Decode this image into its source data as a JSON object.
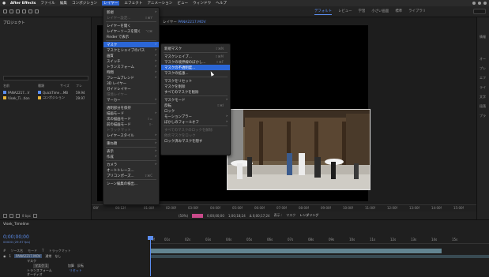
{
  "menubar": {
    "app": "After Effects",
    "items": [
      "ファイル",
      "編集",
      "コンポジション",
      "レイヤー",
      "エフェクト",
      "アニメーション",
      "ビュー",
      "ウィンドウ",
      "ヘルプ"
    ],
    "active_index": 3
  },
  "workspaces": [
    "デフォルト",
    "レビュー",
    "学習",
    "小さい画面",
    "標準",
    "ライブラリ"
  ],
  "project": {
    "title": "プロジェクト",
    "columns": [
      "名前",
      "種類",
      "サイズ",
      "フレ"
    ],
    "items": [
      {
        "name": "PANA2217...V",
        "type": "QuickTime",
        "size": "...MB",
        "fps": "59.94",
        "color": "#5b8def"
      },
      {
        "name": "Visek_Ti...tion",
        "type": "コンポジション",
        "size": "",
        "fps": "29.97",
        "color": "#e7b43a"
      }
    ],
    "bpc": "8 bpc"
  },
  "comp": {
    "tab_label": "レイヤー",
    "tab_name": "PANA2217.MOV",
    "ruler": [
      "00f",
      "00:12f",
      "01:00f",
      "02:00f",
      "03:00f",
      "04:00f",
      "05:00f",
      "06:00f",
      "07:00f",
      "08:00f",
      "09:00f",
      "10:00f",
      "11:00f",
      "12:00f",
      "13:00f",
      "14:00f",
      "15:00f"
    ],
    "viewbar": {
      "zoom": "(50%)",
      "time1": "0;00;00;00",
      "time2": "1;00;18;24",
      "delta": "Δ 0;00;17;24",
      "view_label": "表示 :",
      "view_value": "マスク",
      "render": "レンダリング"
    }
  },
  "right_panel": [
    "情報",
    "オー",
    "プレ",
    "エフ",
    "ライ",
    "文字",
    "段落",
    "ブラ"
  ],
  "timeline": {
    "tab": "Visek_Timeline",
    "time": "0;00;00;00",
    "frames": "00000 (29.97 fps)",
    "cols": [
      "#",
      "ソース名",
      "モード",
      "T",
      "トラックマット"
    ],
    "layers": [
      {
        "num": "1",
        "name": "PANA2217.MOV",
        "mode": "通常",
        "matte": "なし"
      },
      {
        "num": "",
        "name": "マスク",
        "mode": "",
        "matte": ""
      },
      {
        "num": "",
        "name": "マスク 1",
        "mode": "加算",
        "matte": "反転"
      },
      {
        "num": "",
        "name": "トランスフォーム",
        "mode": "リセット",
        "matte": ""
      },
      {
        "num": "",
        "name": "オーディオ",
        "mode": "",
        "matte": ""
      }
    ],
    "ruler": [
      "0f",
      "01s",
      "02s",
      "03s",
      "04s",
      "05s",
      "06s",
      "07s",
      "08s",
      "09s",
      "10s",
      "11s",
      "12s",
      "13s",
      "14s",
      "15s"
    ]
  },
  "menu_layer": {
    "items": [
      {
        "label": "新規",
        "arrow": true
      },
      {
        "label": "レイヤー設定...",
        "disabled": true,
        "shortcut": "⇧⌘Y"
      },
      {
        "sep": true
      },
      {
        "label": "レイヤーを開く"
      },
      {
        "label": "レイヤーソースを開く",
        "shortcut": "⌥⌘"
      },
      {
        "label": "Finder で表示"
      },
      {
        "sep": true
      },
      {
        "label": "マスク",
        "arrow": true,
        "highlight": true
      },
      {
        "label": "マスクとシェイプのパス",
        "arrow": true
      },
      {
        "label": "画質",
        "arrow": true
      },
      {
        "label": "スイッチ",
        "arrow": true
      },
      {
        "label": "トランスフォーム",
        "arrow": true
      },
      {
        "label": "時間",
        "arrow": true
      },
      {
        "label": "フレームブレンド",
        "arrow": true
      },
      {
        "label": "3D レイヤー"
      },
      {
        "label": "ガイドレイヤー"
      },
      {
        "label": "環境レイヤー",
        "disabled": true
      },
      {
        "label": "マーカー",
        "arrow": true
      },
      {
        "sep": true
      },
      {
        "label": "透明部分を保持"
      },
      {
        "label": "描画モード",
        "arrow": true
      },
      {
        "label": "次の描画モード",
        "shortcut": "⇧="
      },
      {
        "label": "前の描画モード",
        "shortcut": "⇧-"
      },
      {
        "label": "トラックマット",
        "disabled": true
      },
      {
        "label": "レイヤースタイル",
        "arrow": true
      },
      {
        "sep": true
      },
      {
        "label": "重ね順",
        "arrow": true
      },
      {
        "sep": true
      },
      {
        "label": "表示",
        "arrow": true
      },
      {
        "label": "作成",
        "arrow": true
      },
      {
        "sep": true
      },
      {
        "label": "カメラ",
        "arrow": true
      },
      {
        "label": "オートトレース..."
      },
      {
        "label": "プリコンポーズ...",
        "shortcut": "⇧⌘C"
      },
      {
        "sep": true
      },
      {
        "label": "シーン編集の検出..."
      }
    ]
  },
  "menu_mask": {
    "items": [
      {
        "label": "新規マスク",
        "shortcut": "⇧⌘N"
      },
      {
        "sep": true
      },
      {
        "label": "マスクシェイプ...",
        "shortcut": "⇧⌘M"
      },
      {
        "label": "マスクの境界線のぼかし...",
        "shortcut": "⇧⌘F"
      },
      {
        "label": "マスクの不透明度...",
        "highlight": true
      },
      {
        "label": "マスクの拡張..."
      },
      {
        "sep": true
      },
      {
        "label": "マスクをリセット"
      },
      {
        "label": "マスクを削除"
      },
      {
        "label": "すべてのマスクを削除"
      },
      {
        "sep": true
      },
      {
        "label": "マスクモード",
        "arrow": true
      },
      {
        "label": "反転",
        "shortcut": "⇧⌘I"
      },
      {
        "label": "ロック"
      },
      {
        "label": "モーションブラー",
        "arrow": true
      },
      {
        "label": "ぼかしのフォールオフ",
        "arrow": true
      },
      {
        "sep": true
      },
      {
        "label": "すべてのマスクのロックを解除",
        "disabled": true
      },
      {
        "label": "他のマスクをロック",
        "disabled": true
      },
      {
        "label": "ロック済みマスクを隠す"
      }
    ]
  }
}
